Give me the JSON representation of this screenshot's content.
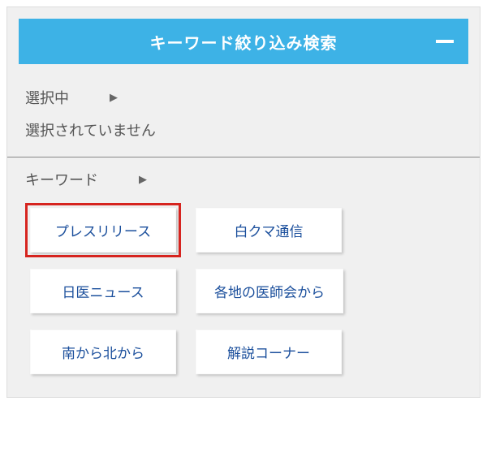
{
  "header": {
    "title": "キーワード絞り込み検索"
  },
  "selected": {
    "label": "選択中",
    "status": "選択されていません"
  },
  "keywords": {
    "label": "キーワード",
    "items": [
      {
        "label": "プレスリリース",
        "highlight": true
      },
      {
        "label": "白クマ通信",
        "highlight": false
      },
      {
        "label": "日医ニュース",
        "highlight": false
      },
      {
        "label": "各地の医師会から",
        "highlight": false
      },
      {
        "label": "南から北から",
        "highlight": false
      },
      {
        "label": "解説コーナー",
        "highlight": false
      }
    ]
  }
}
